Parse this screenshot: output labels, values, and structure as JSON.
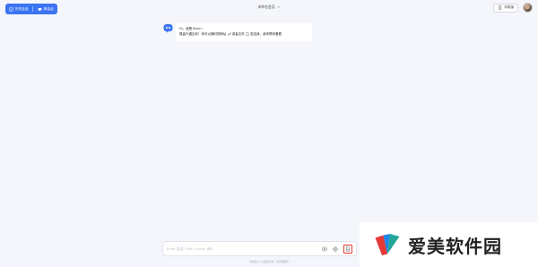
{
  "header": {
    "new_conversation_label": "历史会话",
    "new_chat_label": "新会话",
    "title": "未命名会话",
    "phone_label": "手机版"
  },
  "chat": {
    "messages": [
      {
        "role": "assistant",
        "line1": "Hi，我是 Kimi～",
        "line2_a": "很高兴遇见你！你可以随时把网址",
        "line2_b": "或者文件",
        "line2_c": "发给我，我来帮你看看"
      }
    ]
  },
  "composer": {
    "placeholder": "Enter 发送; Shift + Enter 换行"
  },
  "footer": {
    "text": "内容由 AI 大模型生成，请仔细甄别"
  },
  "watermark": {
    "text": "爱美软件园"
  },
  "colors": {
    "accent": "#3b74f2",
    "background": "#f4f6fb",
    "highlight": "#e53935"
  }
}
